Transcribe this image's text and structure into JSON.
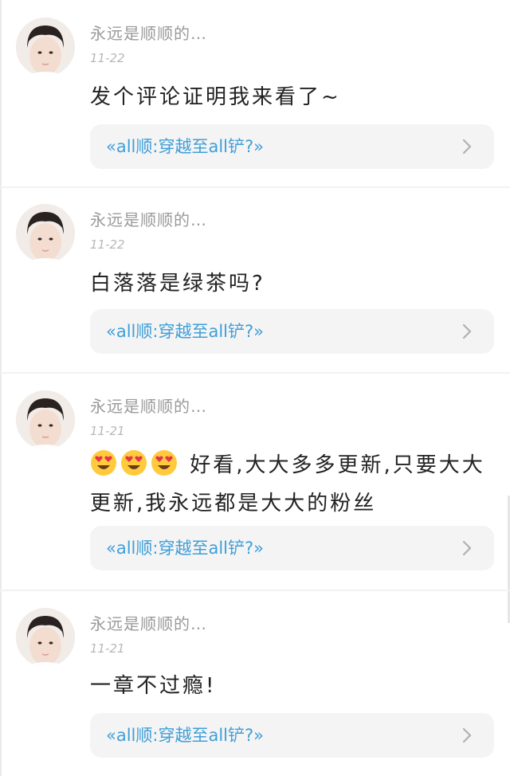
{
  "comments": [
    {
      "username": "永远是顺顺的…",
      "date": "11-22",
      "content": "发个评论证明我来看了~",
      "emojis": [],
      "book": "«all顺:穿越至all铲?»"
    },
    {
      "username": "永远是顺顺的…",
      "date": "11-22",
      "content": "白落落是绿茶吗?",
      "emojis": [],
      "book": "«all顺:穿越至all铲?»"
    },
    {
      "username": "永远是顺顺的…",
      "date": "11-21",
      "content": "好看,大大多多更新,只要大大更新,我永远都是大大的粉丝",
      "emojis": [
        "heart-eyes-emoji",
        "heart-eyes-emoji",
        "heart-eyes-emoji"
      ],
      "book": "«all顺:穿越至all铲?»"
    },
    {
      "username": "永远是顺顺的…",
      "date": "11-21",
      "content": "一章不过瘾!",
      "emojis": [],
      "book": "«all顺:穿越至all铲?»"
    }
  ],
  "colors": {
    "book_link": "#3f9fd8",
    "card_bg": "#f4f4f4",
    "username": "#9a9a9a",
    "date": "#b8b8b8"
  }
}
